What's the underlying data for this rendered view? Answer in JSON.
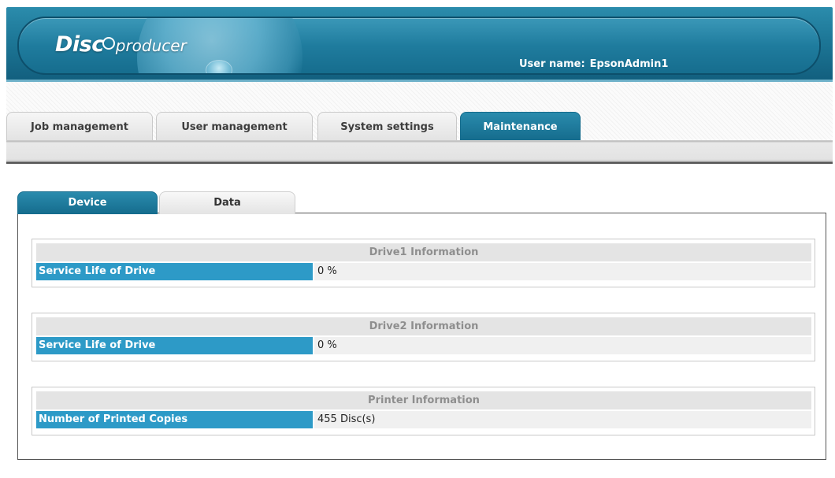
{
  "header": {
    "logo_disc": "Disc",
    "logo_producer": "producer",
    "user_label": "User name:",
    "user_name": "EpsonAdmin1"
  },
  "main_tabs": [
    {
      "label": "Job management",
      "active": false
    },
    {
      "label": "User management",
      "active": false
    },
    {
      "label": "System settings",
      "active": false
    },
    {
      "label": "Maintenance",
      "active": true
    }
  ],
  "sub_tabs": [
    {
      "label": "Device",
      "active": true
    },
    {
      "label": "Data",
      "active": false
    }
  ],
  "panels": [
    {
      "title": "Drive1 Information",
      "label": "Service Life of Drive",
      "value": "0 %"
    },
    {
      "title": "Drive2 Information",
      "label": "Service Life of Drive",
      "value": "0 %"
    },
    {
      "title": "Printer Information",
      "label": "Number of Printed Copies",
      "value": "455 Disc(s)"
    }
  ],
  "colors": {
    "header_teal": "#1d7797",
    "active_tab": "#1f7c9e",
    "label_blue": "#2d9ac7",
    "panel_title_bg": "#e4e4e4"
  }
}
